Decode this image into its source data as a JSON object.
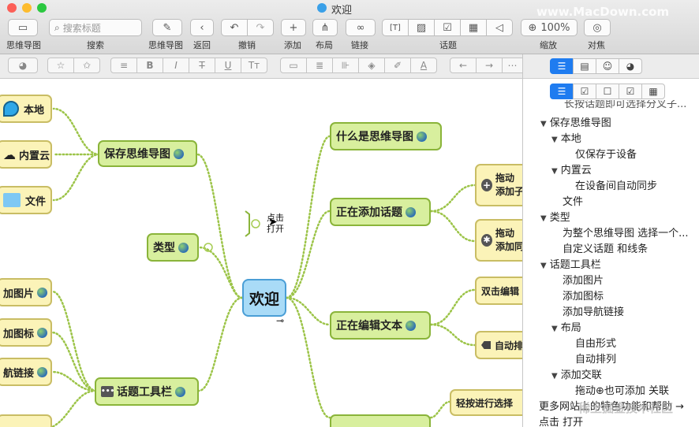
{
  "window": {
    "title": "欢迎",
    "watermark": "www.MacDown.com"
  },
  "toolbar": {
    "mindmap_label": "思维导图",
    "search_placeholder": "搜索标题",
    "search_label": "搜索",
    "mindmap2_label": "思维导图",
    "back_label": "返回",
    "undo_label": "撤销",
    "add_label": "添加",
    "layout_label": "布局",
    "link_label": "链接",
    "topic_label": "话题",
    "zoom_value": "100%",
    "zoom_label": "缩放",
    "align_label": "对焦"
  },
  "canvas": {
    "center": "欢迎",
    "nodes": {
      "local": "本地",
      "cloud": "内置云",
      "file": "文件",
      "save": "保存思维导图",
      "type": "类型",
      "add_image": "加图片",
      "add_icon": "加图标",
      "nav_link": "航链接",
      "toolbar": "话题工具栏",
      "what": "什么是思维导图",
      "adding": "正在添加话题",
      "drag1a": "拖动",
      "drag1b": "添加子",
      "drag2a": "拖动",
      "drag2b": "添加同",
      "editing": "正在编辑文本",
      "dblclick": "双击编辑",
      "auto": "自动排",
      "tap_select": "轻按进行选择"
    },
    "hint_line1": "点击",
    "hint_line2": "打开"
  },
  "sidebar": {
    "lines": [
      {
        "text": "长按话题即可选择分叉子..."
      },
      {
        "text": "保存思维导图",
        "tri": "▼"
      },
      {
        "text": "本地",
        "tri": "▼"
      },
      {
        "text": "仅保存于设备"
      },
      {
        "text": "内置云",
        "tri": "▼"
      },
      {
        "text": "在设备间自动同步"
      },
      {
        "text": "文件"
      },
      {
        "text": "类型",
        "tri": "▼"
      },
      {
        "text": "为整个思维导图 选择一个..."
      },
      {
        "text": "自定义话题 和线条"
      },
      {
        "text": "话题工具栏",
        "tri": "▼"
      },
      {
        "text": "添加图片"
      },
      {
        "text": "添加图标"
      },
      {
        "text": "添加导航链接"
      },
      {
        "text": "布局",
        "tri": "▼"
      },
      {
        "text": "自由形式"
      },
      {
        "text": "自动排列"
      },
      {
        "text": "添加交联",
        "tri": "▼"
      },
      {
        "text": "拖动⊕也可添加 关联"
      },
      {
        "text": "更多网站上的特色功能和帮助 →"
      },
      {
        "text": "点击 打开"
      }
    ],
    "footer_watermark": "稀土掘金技术社区"
  }
}
